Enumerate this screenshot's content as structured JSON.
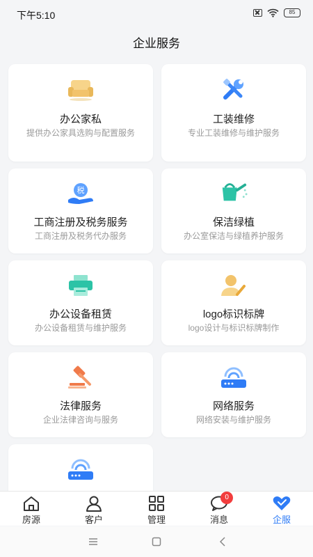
{
  "status": {
    "time": "下午5:10",
    "battery": "85"
  },
  "title": "企业服务",
  "cards": [
    {
      "title": "办公家私",
      "desc": "提供办公家具选购与配置服务",
      "icon": "sofa-icon"
    },
    {
      "title": "工装维修",
      "desc": "专业工装维修与维护服务",
      "icon": "tools-icon"
    },
    {
      "title": "工商注册及税务服务",
      "desc": "工商注册及税务代办服务",
      "icon": "tax-icon"
    },
    {
      "title": "保洁绿植",
      "desc": "办公室保洁与绿植养护服务",
      "icon": "watering-can-icon"
    },
    {
      "title": "办公设备租赁",
      "desc": "办公设备租赁与维护服务",
      "icon": "printer-icon"
    },
    {
      "title": "logo标识标牌",
      "desc": "logo设计与标识标牌制作",
      "icon": "user-edit-icon"
    },
    {
      "title": "法律服务",
      "desc": "企业法律咨询与服务",
      "icon": "gavel-icon"
    },
    {
      "title": "网络服务",
      "desc": "网络安装与维护服务",
      "icon": "router-icon"
    },
    {
      "title": "",
      "desc": "",
      "icon": "router-icon"
    }
  ],
  "tabs": [
    {
      "label": "房源",
      "icon": "home-icon"
    },
    {
      "label": "客户",
      "icon": "user-icon"
    },
    {
      "label": "管理",
      "icon": "grid-icon"
    },
    {
      "label": "消息",
      "icon": "message-icon",
      "badge": "0"
    },
    {
      "label": "企服",
      "icon": "heart-icon",
      "active": true
    }
  ],
  "colors": {
    "accent": "#2f7cf6",
    "badge": "#f23d3d"
  }
}
